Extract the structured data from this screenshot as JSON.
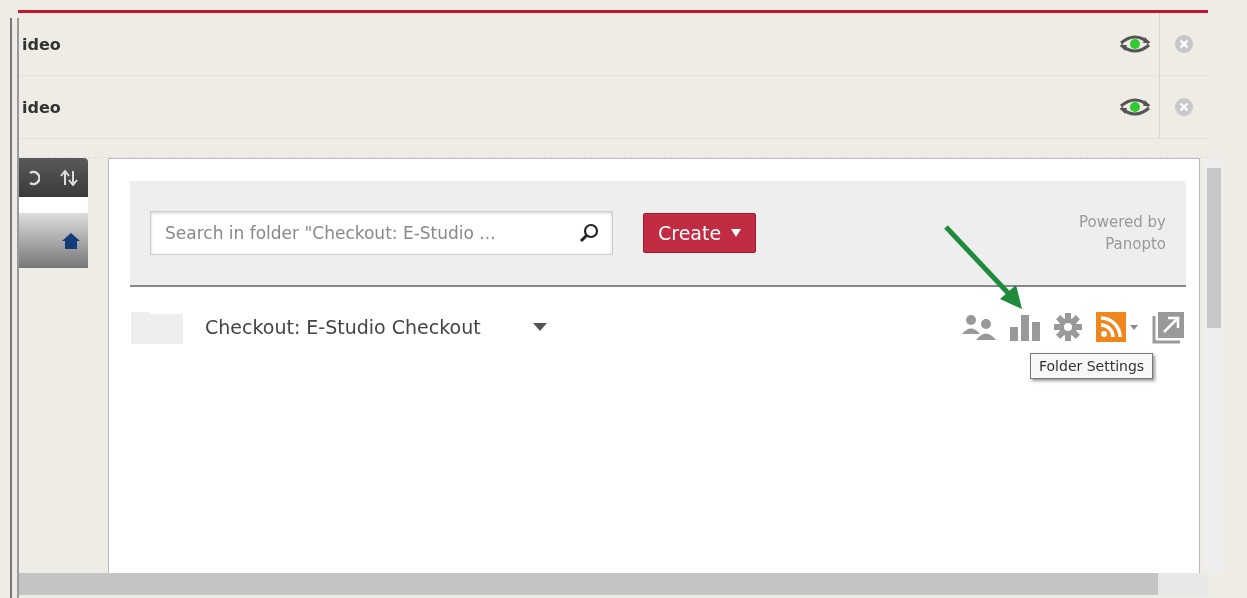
{
  "session_rows": [
    {
      "label": "ideo"
    },
    {
      "label": "ideo"
    }
  ],
  "search": {
    "placeholder": "Search in folder \"Checkout: E-Studio ..."
  },
  "create_button": {
    "label": "Create"
  },
  "branding": "Powered by Panopto",
  "folder": {
    "name": "Checkout: E-Studio Checkout"
  },
  "tooltip": "Folder Settings"
}
